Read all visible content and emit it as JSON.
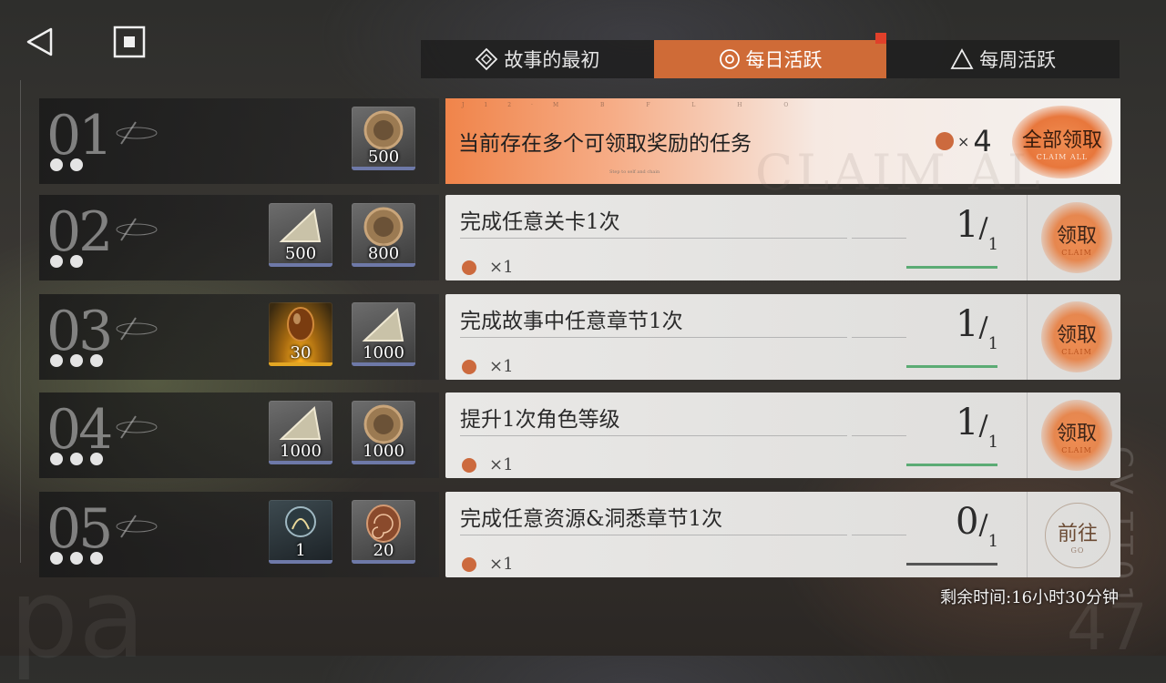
{
  "tabs": [
    {
      "label": "故事的最初",
      "icon": "diamond-icon",
      "active": false
    },
    {
      "label": "每日活跃",
      "icon": "circle-target-icon",
      "active": true
    },
    {
      "label": "每周活跃",
      "icon": "triangle-icon",
      "active": false
    }
  ],
  "claim_all": {
    "title": "当前存在多个可领取奖励的任务",
    "count_prefix": "×",
    "count": "4",
    "button_label": "全部领取",
    "button_sub": "CLAIM ALL",
    "bg_text": "CLAIM AL",
    "code_text": "J12·M  B F L H O",
    "small_text": "Step to self and chain"
  },
  "rows": [
    {
      "num": "01",
      "dots": 2,
      "items": [
        {
          "type": "coin",
          "qty": "500"
        }
      ]
    },
    {
      "num": "02",
      "dots": 2,
      "items": [
        {
          "type": "shard",
          "qty": "500"
        },
        {
          "type": "coin",
          "qty": "800"
        }
      ],
      "task": {
        "title": "完成任意关卡1次",
        "reward": "×1",
        "progress_current": "1",
        "progress_total": "1",
        "button_label": "领取",
        "button_sub": "CLAIM",
        "state": "claim"
      }
    },
    {
      "num": "03",
      "dots": 3,
      "items": [
        {
          "type": "gem",
          "qty": "30"
        },
        {
          "type": "shard",
          "qty": "1000"
        }
      ],
      "task": {
        "title": "完成故事中任意章节1次",
        "reward": "×1",
        "progress_current": "1",
        "progress_total": "1",
        "button_label": "领取",
        "button_sub": "CLAIM",
        "state": "claim"
      }
    },
    {
      "num": "04",
      "dots": 3,
      "items": [
        {
          "type": "shard",
          "qty": "1000"
        },
        {
          "type": "coin",
          "qty": "1000"
        }
      ],
      "task": {
        "title": "提升1次角色等级",
        "reward": "×1",
        "progress_current": "1",
        "progress_total": "1",
        "button_label": "领取",
        "button_sub": "CLAIM",
        "state": "claim"
      }
    },
    {
      "num": "05",
      "dots": 3,
      "items": [
        {
          "type": "orb",
          "qty": "1"
        },
        {
          "type": "fossil",
          "qty": "20"
        }
      ],
      "task": {
        "title": "完成任意资源&洞悉章节1次",
        "reward": "×1",
        "progress_current": "0",
        "progress_total": "1",
        "button_label": "前往",
        "button_sub": "GO",
        "state": "go"
      }
    }
  ],
  "remaining_time": "剩余时间:16小时30分钟",
  "bg": {
    "letters": "pa",
    "code": "CV-TT01",
    "num": "47"
  },
  "colors": {
    "accent": "#cf6b37",
    "reward_dot": "#cc6a3e",
    "progress": "#5bab74"
  }
}
